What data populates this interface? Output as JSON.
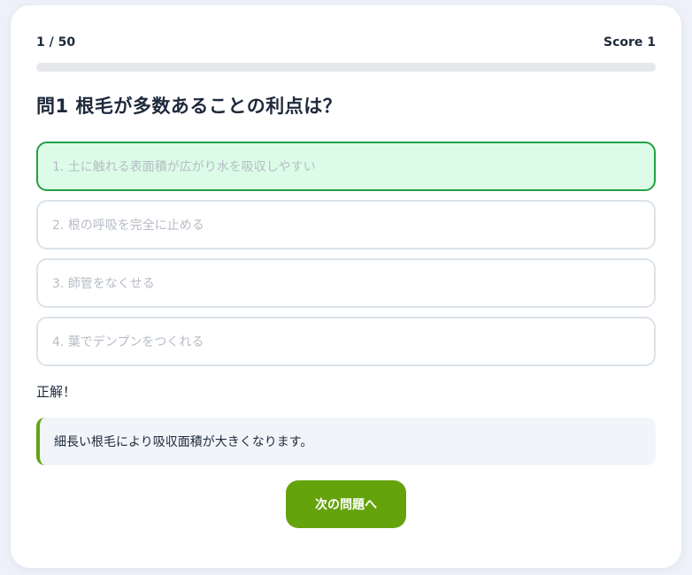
{
  "header": {
    "progress_text": "1 / 50",
    "score_text": "Score 1"
  },
  "progress": {
    "current": 1,
    "total": 50,
    "fill_fraction": 0.0
  },
  "question": {
    "text": "問1 根毛が多数あることの利点は？"
  },
  "options": [
    {
      "label": "1. 土に触れる表面積が広がり水を吸収しやすい",
      "state": "correct"
    },
    {
      "label": "2. 根の呼吸を完全に止める",
      "state": "default"
    },
    {
      "label": "3. 師管をなくせる",
      "state": "default"
    },
    {
      "label": "4. 葉でデンプンをつくれる",
      "state": "default"
    }
  ],
  "feedback": {
    "result_text": "正解！",
    "explanation_text": "細長い根毛により吸収面積が大きくなります。"
  },
  "actions": {
    "next_label": "次の問題へ"
  },
  "colors": {
    "accent": "#65a30d",
    "correct_border": "#22a045",
    "correct_background": "#dcfce7",
    "option_border": "#dbe3ea",
    "page_background": "#eef1f9"
  }
}
